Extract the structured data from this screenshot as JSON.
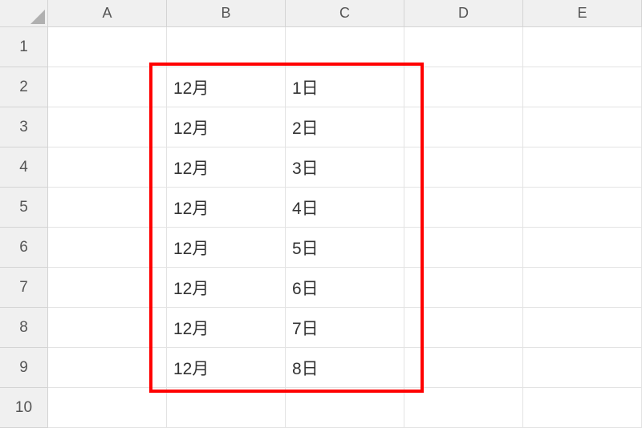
{
  "columns": [
    "A",
    "B",
    "C",
    "D",
    "E"
  ],
  "rows": [
    "1",
    "2",
    "3",
    "4",
    "5",
    "6",
    "7",
    "8",
    "9",
    "10"
  ],
  "cells": {
    "B2": "12月",
    "C2": "1日",
    "B3": "12月",
    "C3": "2日",
    "B4": "12月",
    "C4": "3日",
    "B5": "12月",
    "C5": "4日",
    "B6": "12月",
    "C6": "5日",
    "B7": "12月",
    "C7": "6日",
    "B8": "12月",
    "C8": "7日",
    "B9": "12月",
    "C9": "8日"
  },
  "highlight": {
    "color": "#ff0000",
    "range": "B2:C9"
  }
}
